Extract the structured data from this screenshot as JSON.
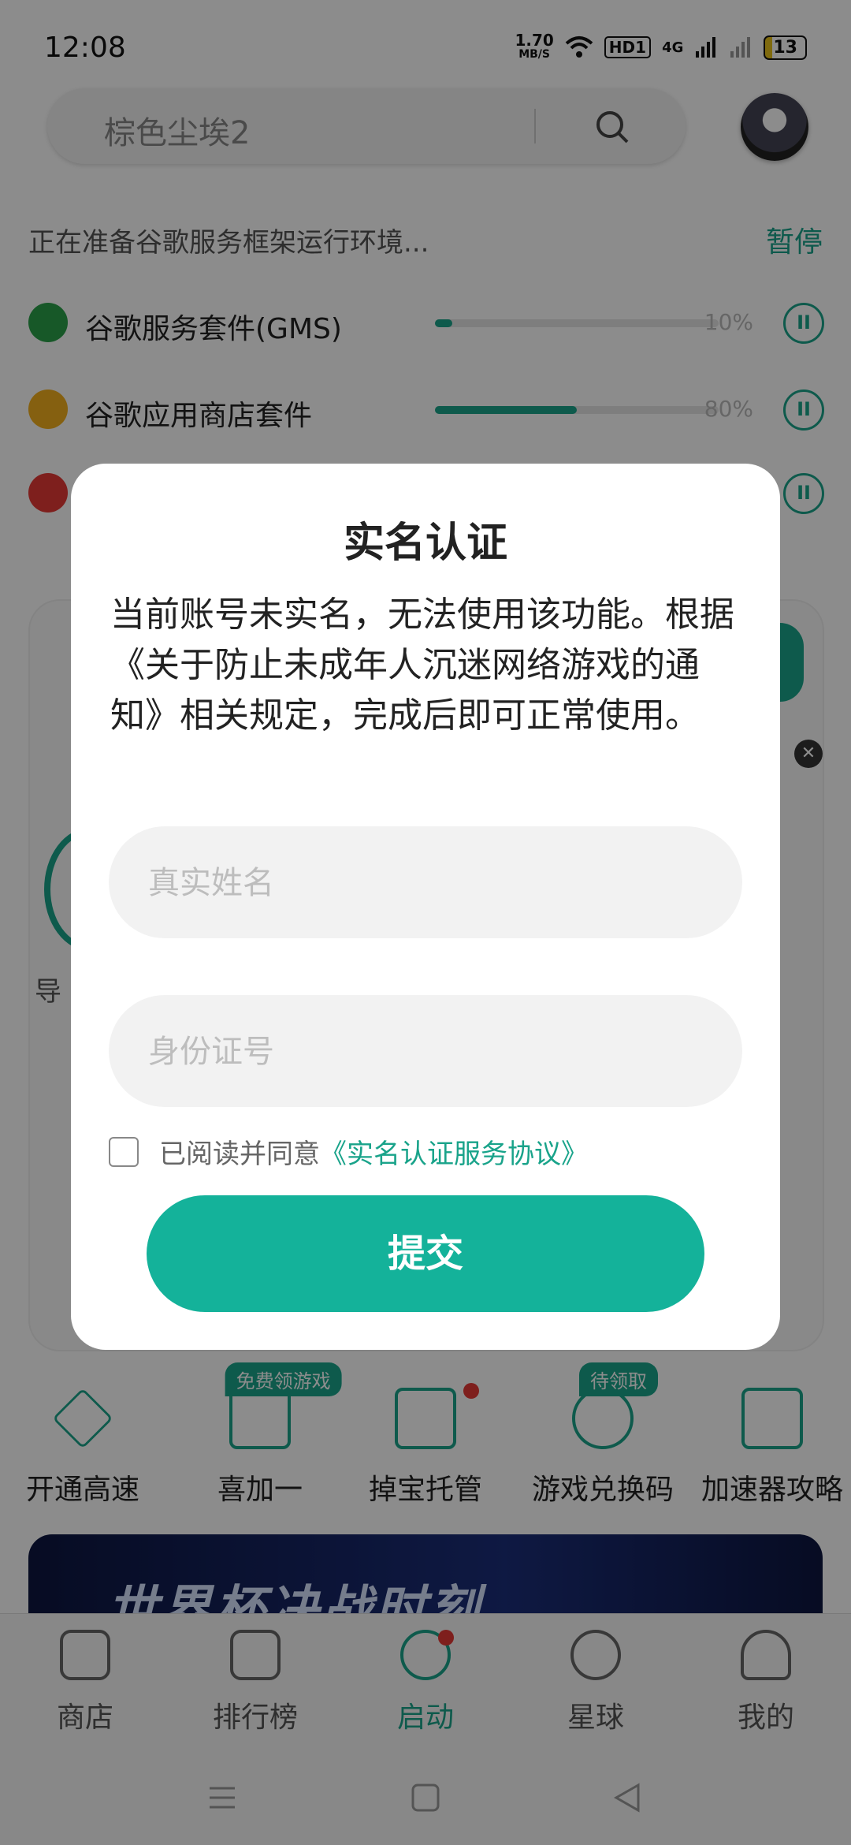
{
  "status_bar": {
    "time": "12:08",
    "speed_value": "1.70",
    "speed_unit": "MB/S",
    "hd": "HD1",
    "network": "4G",
    "battery": "13"
  },
  "search": {
    "placeholder": "棕色尘埃2"
  },
  "prep": {
    "message": "正在准备谷歌服务框架运行环境...",
    "pause_label": "暂停"
  },
  "downloads": [
    {
      "label": "谷歌服务套件(GMS)",
      "percent": "10%",
      "progress": 0.06,
      "color": "#2aa04a"
    },
    {
      "label": "谷歌应用商店套件",
      "percent": "80%",
      "progress": 0.5,
      "color": "#f2b01e"
    },
    {
      "label": "",
      "percent": "",
      "progress": 0.0,
      "color": "#e53935"
    }
  ],
  "background": {
    "section_label": "导"
  },
  "quick_actions": [
    {
      "label": "开通高速",
      "icon": "diamond-icon",
      "badge": ""
    },
    {
      "label": "喜加一",
      "icon": "gift-icon",
      "badge": "免费领游戏"
    },
    {
      "label": "掉宝托管",
      "icon": "twitch-icon",
      "badge": ""
    },
    {
      "label": "游戏兑换码",
      "icon": "exchange-icon",
      "badge": "待领取"
    },
    {
      "label": "加速器攻略",
      "icon": "guide-icon",
      "badge": ""
    }
  ],
  "banner": {
    "text": "世界杯决战时刻"
  },
  "bottom_nav": [
    {
      "label": "商店",
      "icon": "home-icon"
    },
    {
      "label": "排行榜",
      "icon": "chart-icon"
    },
    {
      "label": "启动",
      "icon": "play-icon",
      "active": true
    },
    {
      "label": "星球",
      "icon": "planet-icon"
    },
    {
      "label": "我的",
      "icon": "user-icon"
    }
  ],
  "dialog": {
    "title": "实名认证",
    "message": "当前账号未实名，无法使用该功能。根据《关于防止未成年人沉迷网络游戏的通知》相关规定，完成后即可正常使用。",
    "name_placeholder": "真实姓名",
    "id_placeholder": "身份证号",
    "agree_text": "已阅读并同意",
    "agree_link": "《实名认证服务协议》",
    "submit_label": "提交"
  },
  "colors": {
    "accent": "#14b29a",
    "overlay": "rgba(0,0,0,0.45)"
  }
}
